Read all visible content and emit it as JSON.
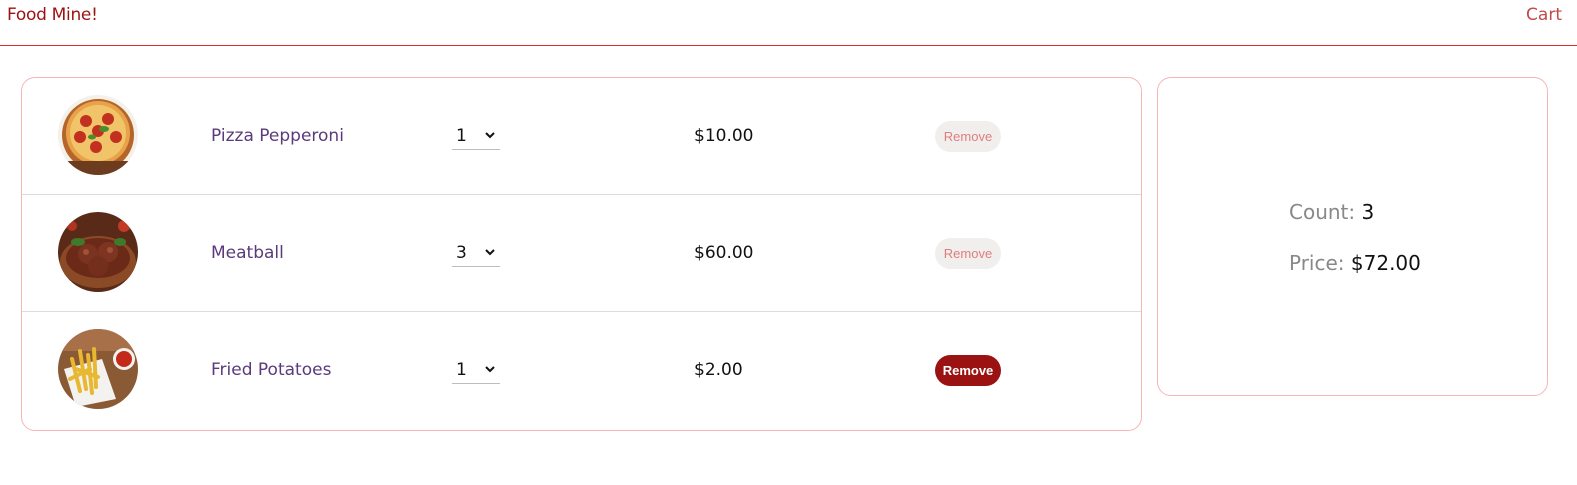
{
  "header": {
    "brand": "Food Mine!",
    "cart_label": "Cart"
  },
  "cart": {
    "items": [
      {
        "name": "Pizza Pepperoni",
        "quantity": "1",
        "price": "$10.00",
        "remove_label": "Remove",
        "image_icon": "pizza-image"
      },
      {
        "name": "Meatball",
        "quantity": "3",
        "price": "$60.00",
        "remove_label": "Remove",
        "image_icon": "meatball-image"
      },
      {
        "name": "Fried Potatoes",
        "quantity": "1",
        "price": "$2.00",
        "remove_label": "Remove",
        "image_icon": "fries-image"
      }
    ]
  },
  "summary": {
    "count_label": "Count:",
    "count_value": "3",
    "price_label": "Price:",
    "price_value": "$72.00"
  },
  "colors": {
    "brand": "#9b1212",
    "accent_border": "#f7b5b5",
    "item_name": "#5b3a7c",
    "remove_active": "#9b1212"
  }
}
